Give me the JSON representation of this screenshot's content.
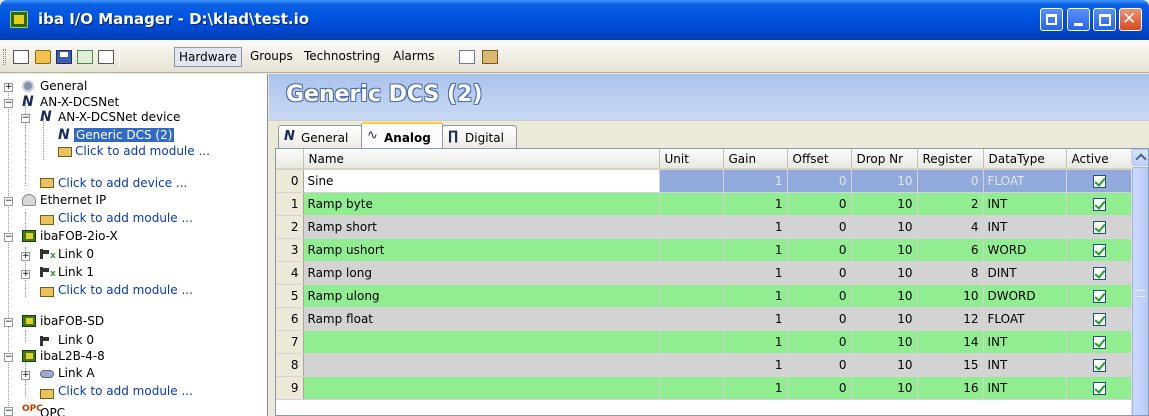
{
  "window": {
    "title": "iba I/O Manager - D:\\klad\\test.io"
  },
  "toolbar": {
    "tabs": [
      "Hardware",
      "Groups",
      "Technostring",
      "Alarms"
    ],
    "active_tab": "Hardware"
  },
  "tree": {
    "general": "General",
    "anx_dcsnet": "AN-X-DCSNet",
    "anx_device": "AN-X-DCSNet device",
    "generic_dcs": "Generic DCS (2)",
    "add_module_1": "Click to add module ...",
    "add_device": "Click to add device ...",
    "ethernet_ip": "Ethernet IP",
    "add_module_2": "Click to add module ...",
    "ibafob_2io": "ibaFOB-2io-X",
    "link0": "Link 0",
    "link1": "Link 1",
    "add_module_3": "Click to add module ...",
    "ibafob_sd": "ibaFOB-SD",
    "sd_link0": "Link 0",
    "ibal2b": "ibaL2B-4-8",
    "link_a": "Link A",
    "add_module_4": "Click to add module ...",
    "opc": "OPC"
  },
  "panel": {
    "title": "Generic DCS (2)",
    "tabs": [
      "General",
      "Analog",
      "Digital"
    ],
    "active_tab": "Analog"
  },
  "grid": {
    "columns": [
      "Name",
      "Unit",
      "Gain",
      "Offset",
      "Drop Nr",
      "Register",
      "DataType",
      "Active"
    ],
    "rows": [
      {
        "idx": "0",
        "name": "Sine",
        "unit": "",
        "gain": "1",
        "offset": "0",
        "drop": "10",
        "register": "0",
        "datatype": "FLOAT",
        "active": true
      },
      {
        "idx": "1",
        "name": "Ramp byte",
        "unit": "",
        "gain": "1",
        "offset": "0",
        "drop": "10",
        "register": "2",
        "datatype": "INT",
        "active": true
      },
      {
        "idx": "2",
        "name": "Ramp short",
        "unit": "",
        "gain": "1",
        "offset": "0",
        "drop": "10",
        "register": "4",
        "datatype": "INT",
        "active": true
      },
      {
        "idx": "3",
        "name": "Ramp ushort",
        "unit": "",
        "gain": "1",
        "offset": "0",
        "drop": "10",
        "register": "6",
        "datatype": "WORD",
        "active": true
      },
      {
        "idx": "4",
        "name": "Ramp long",
        "unit": "",
        "gain": "1",
        "offset": "0",
        "drop": "10",
        "register": "8",
        "datatype": "DINT",
        "active": true
      },
      {
        "idx": "5",
        "name": "Ramp ulong",
        "unit": "",
        "gain": "1",
        "offset": "0",
        "drop": "10",
        "register": "10",
        "datatype": "DWORD",
        "active": true
      },
      {
        "idx": "6",
        "name": "Ramp float",
        "unit": "",
        "gain": "1",
        "offset": "0",
        "drop": "10",
        "register": "12",
        "datatype": "FLOAT",
        "active": true
      },
      {
        "idx": "7",
        "name": "",
        "unit": "",
        "gain": "1",
        "offset": "0",
        "drop": "10",
        "register": "14",
        "datatype": "INT",
        "active": true
      },
      {
        "idx": "8",
        "name": "",
        "unit": "",
        "gain": "1",
        "offset": "0",
        "drop": "10",
        "register": "15",
        "datatype": "INT",
        "active": true
      },
      {
        "idx": "9",
        "name": "",
        "unit": "",
        "gain": "1",
        "offset": "0",
        "drop": "10",
        "register": "16",
        "datatype": "INT",
        "active": true
      }
    ]
  },
  "colors": {
    "titlebar": "#0054e3",
    "row_green": "#90ee90",
    "row_gray": "#d3d3d3",
    "selected_row": "#92a9dc",
    "tree_selected": "#316ac5"
  }
}
